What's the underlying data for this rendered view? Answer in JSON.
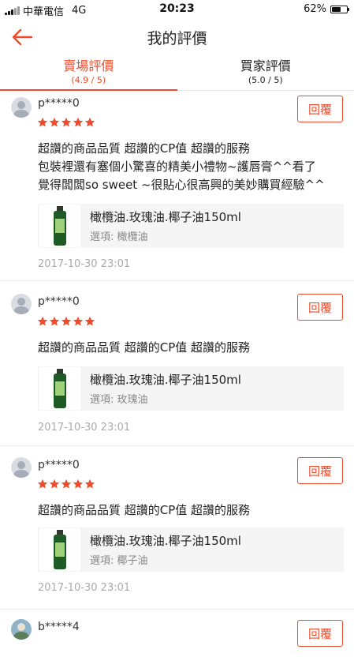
{
  "status_bar": {
    "carrier": "中華電信",
    "network": "4G",
    "time": "20:23",
    "battery": "62%",
    "battery_level": 0.62
  },
  "nav": {
    "title": "我的評價"
  },
  "tabs": [
    {
      "label": "賣場評價",
      "sub": "(4.9 / 5)"
    },
    {
      "label": "買家評價",
      "sub": "(5.0 / 5)"
    }
  ],
  "reviews": [
    {
      "user": "p*****0",
      "rating": 5,
      "reply": "回覆",
      "comment": [
        "超讚的商品品質 超讚的CP值 超讚的服務",
        "包裝裡還有塞個小驚喜的精美小禮物~護唇膏^^看了",
        "覺得闆闆so sweet ~很貼心很高興的美妙購買經驗^^"
      ],
      "product": {
        "name": "橄欖油.玫瑰油.椰子油150ml",
        "option": "選項: 橄欖油"
      },
      "date": "2017-10-30 23:01"
    },
    {
      "user": "p*****0",
      "rating": 5,
      "reply": "回覆",
      "comment": [
        "超讚的商品品質 超讚的CP值 超讚的服務"
      ],
      "product": {
        "name": "橄欖油.玫瑰油.椰子油150ml",
        "option": "選項: 玫瑰油"
      },
      "date": "2017-10-30 23:01"
    },
    {
      "user": "p*****0",
      "rating": 5,
      "reply": "回覆",
      "comment": [
        "超讚的商品品質 超讚的CP值 超讚的服務"
      ],
      "product": {
        "name": "橄欖油.玫瑰油.椰子油150ml",
        "option": "選項: 椰子油"
      },
      "date": "2017-10-30 23:01"
    },
    {
      "user": "b*****4",
      "reply": "回覆"
    }
  ],
  "colors": {
    "accent": "#ee4d2d"
  }
}
